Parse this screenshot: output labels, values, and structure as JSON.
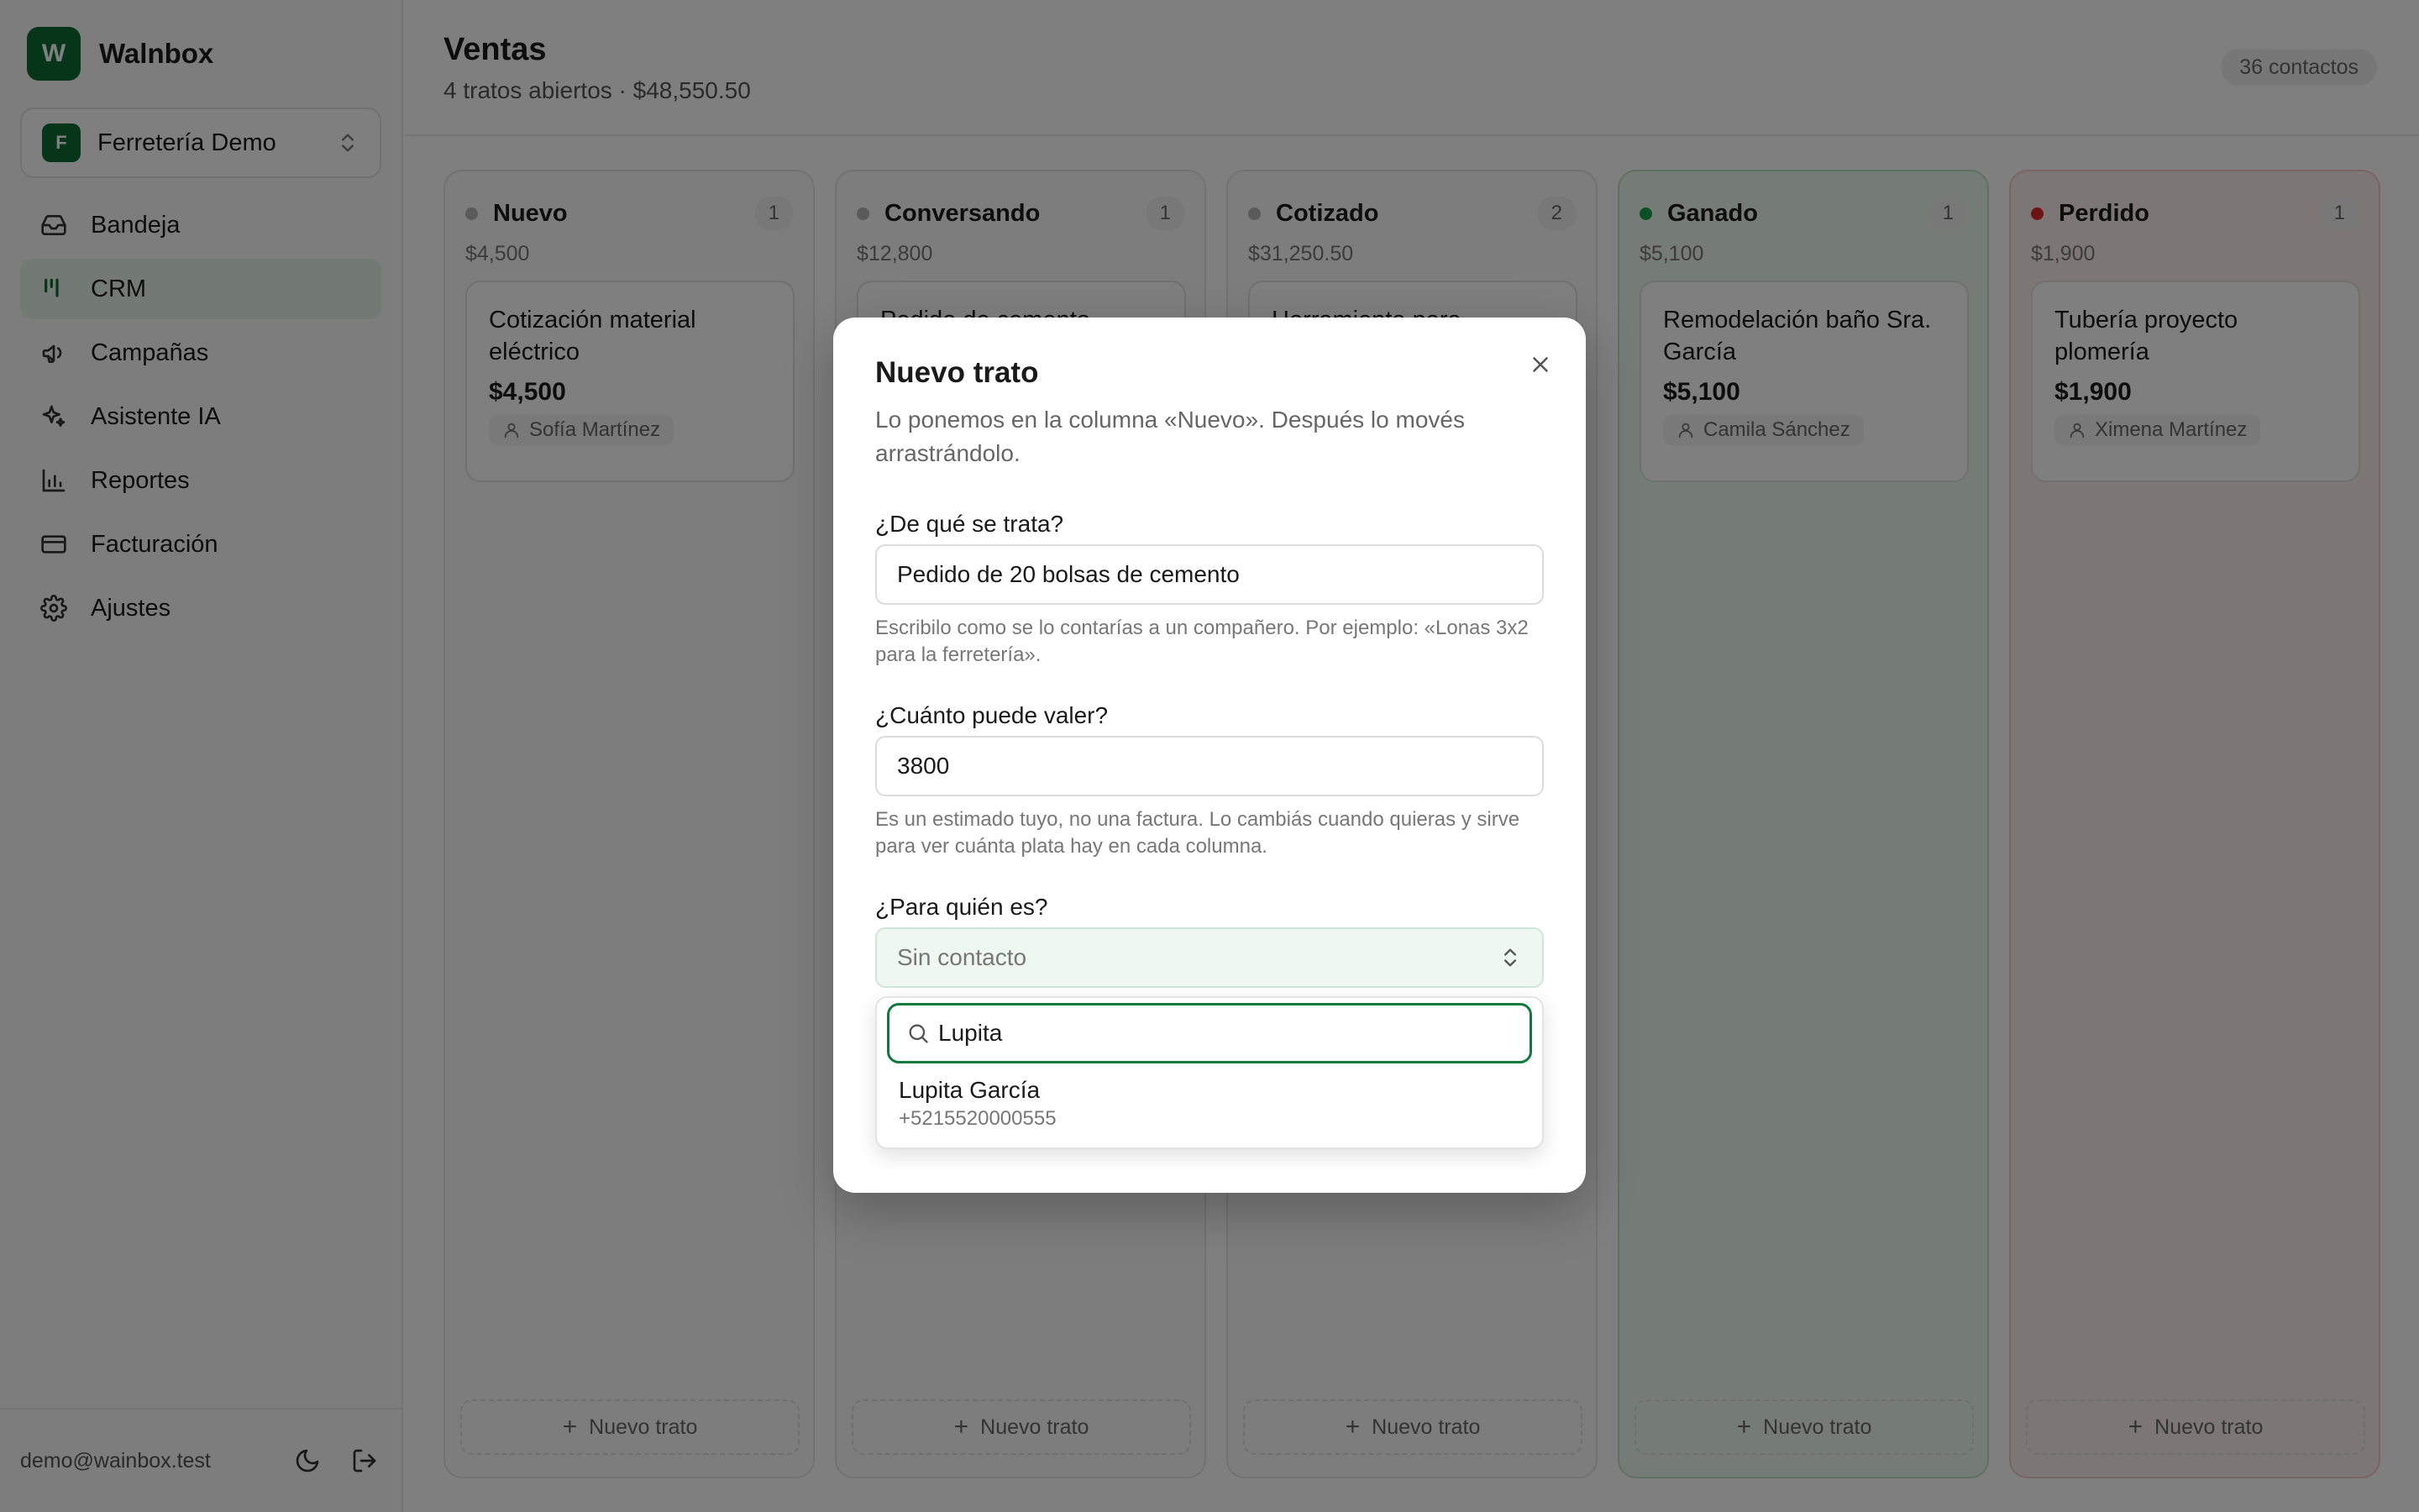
{
  "app": {
    "logo_letter": "W",
    "name": "Walnbox"
  },
  "org": {
    "avatar_letter": "F",
    "name": "Ferretería Demo"
  },
  "nav": [
    {
      "label": "Bandeja",
      "icon": "inbox-icon",
      "active": false
    },
    {
      "label": "CRM",
      "icon": "kanban-icon",
      "active": true
    },
    {
      "label": "Campañas",
      "icon": "megaphone-icon",
      "active": false
    },
    {
      "label": "Asistente IA",
      "icon": "sparkles-icon",
      "active": false
    },
    {
      "label": "Reportes",
      "icon": "bar-chart-icon",
      "active": false
    },
    {
      "label": "Facturación",
      "icon": "credit-card-icon",
      "active": false
    },
    {
      "label": "Ajustes",
      "icon": "gear-icon",
      "active": false
    }
  ],
  "footer": {
    "email": "demo@wainbox.test"
  },
  "header": {
    "title": "Ventas",
    "subtitle": "4 tratos abiertos · $48,550.50",
    "contacts_badge": "36 contactos"
  },
  "columns": [
    {
      "name": "Nuevo",
      "count": "1",
      "total": "$4,500",
      "status": "gray",
      "card": {
        "title": "Cotización material eléctrico",
        "value": "$4,500",
        "contact": "Sofía Martínez"
      }
    },
    {
      "name": "Conversando",
      "count": "1",
      "total": "$12,800",
      "status": "gray",
      "card": {
        "title": "Pedido de cemento",
        "value": "",
        "contact": ""
      }
    },
    {
      "name": "Cotizado",
      "count": "2",
      "total": "$31,250.50",
      "status": "gray",
      "card": {
        "title": "Herramienta para",
        "value": "",
        "contact": ""
      }
    },
    {
      "name": "Ganado",
      "count": "1",
      "total": "$5,100",
      "status": "green",
      "card": {
        "title": "Remodelación baño Sra. García",
        "value": "$5,100",
        "contact": "Camila Sánchez"
      }
    },
    {
      "name": "Perdido",
      "count": "1",
      "total": "$1,900",
      "status": "red",
      "card": {
        "title": "Tubería proyecto plomería",
        "value": "$1,900",
        "contact": "Ximena Martínez"
      }
    }
  ],
  "add_deal_label": "Nuevo trato",
  "modal": {
    "title": "Nuevo trato",
    "description": "Lo ponemos en la columna «Nuevo». Después lo movés arrastrándolo.",
    "topic_label": "¿De qué se trata?",
    "topic_value": "Pedido de 20 bolsas de cemento",
    "topic_help": "Escribilo como se lo contarías a un compañero. Por ejemplo: «Lonas 3x2 para la ferretería».",
    "value_label": "¿Cuánto puede valer?",
    "value_value": "3800",
    "value_help": "Es un estimado tuyo, no una factura. Lo cambiás cuando quieras y sirve para ver cuánta plata hay en cada columna.",
    "contact_label": "¿Para quién es?",
    "contact_selected": "Sin contacto",
    "search_value": "Lupita",
    "options": [
      {
        "name": "Lupita García",
        "phone": "+5215520000555"
      }
    ]
  },
  "colors": {
    "brand": "#0f6b34",
    "active_nav": "#e7f3ea",
    "won": "#16a34a",
    "lost": "#dc2626"
  }
}
